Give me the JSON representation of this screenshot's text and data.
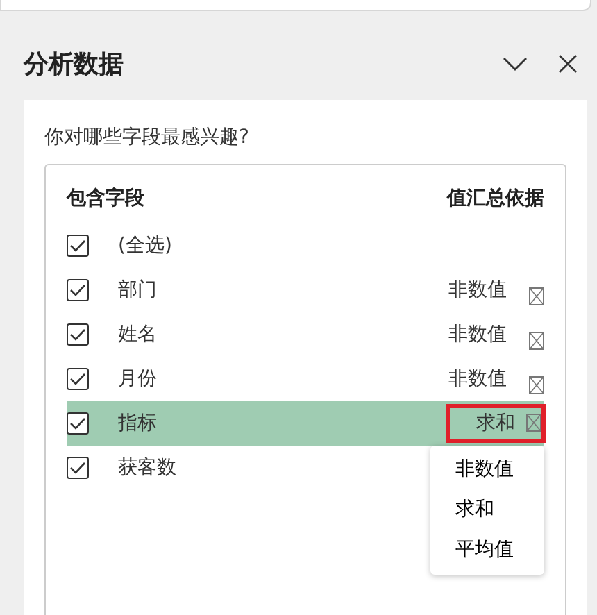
{
  "panel": {
    "title": "分析数据"
  },
  "question": "你对哪些字段最感兴趣?",
  "columns": [
    "包含字段",
    "值汇总依据"
  ],
  "fields": [
    {
      "label": "(全选)",
      "checked": true,
      "selected": false
    },
    {
      "label": "部门",
      "checked": true,
      "selected": false,
      "value": "非数值"
    },
    {
      "label": "姓名",
      "checked": true,
      "selected": false,
      "value": "非数值"
    },
    {
      "label": "月份",
      "checked": true,
      "selected": false,
      "value": "非数值"
    },
    {
      "label": "指标",
      "checked": true,
      "selected": true,
      "value": "求和"
    },
    {
      "label": "获客数",
      "checked": true,
      "selected": false
    }
  ],
  "dropdown": {
    "options": [
      "非数值",
      "求和",
      "平均值"
    ]
  }
}
